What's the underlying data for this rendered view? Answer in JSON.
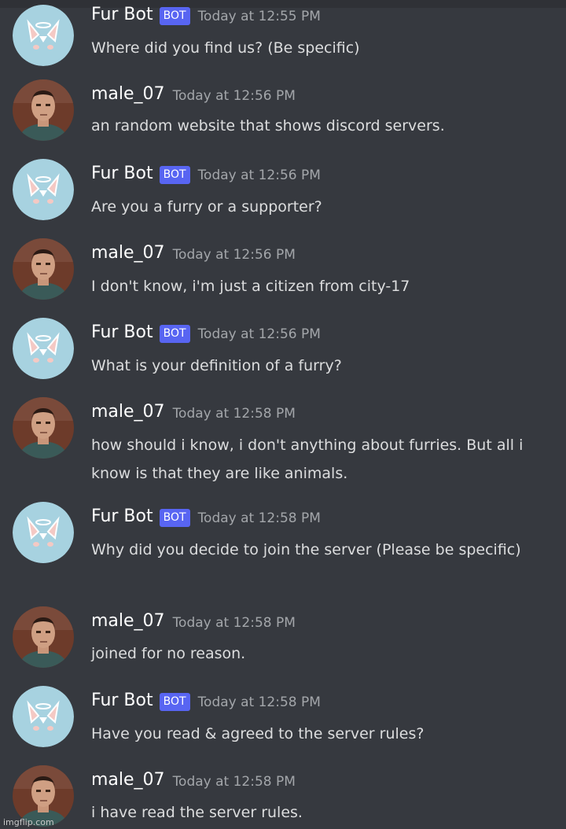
{
  "messages": [
    {
      "author": "Fur Bot",
      "bot": true,
      "badge": "BOT",
      "timestamp": "Today at 12:55 PM",
      "text": "Where did you find us? (Be specific)"
    },
    {
      "author": "male_07",
      "bot": false,
      "timestamp": "Today at 12:56 PM",
      "text": "an random website that shows discord servers."
    },
    {
      "author": "Fur Bot",
      "bot": true,
      "badge": "BOT",
      "timestamp": "Today at 12:56 PM",
      "text": "Are you a furry or a supporter?"
    },
    {
      "author": "male_07",
      "bot": false,
      "timestamp": "Today at 12:56 PM",
      "text": "I don't know, i'm just a citizen from city-17"
    },
    {
      "author": "Fur Bot",
      "bot": true,
      "badge": "BOT",
      "timestamp": "Today at 12:56 PM",
      "text": "What is your definition of a furry?"
    },
    {
      "author": "male_07",
      "bot": false,
      "timestamp": "Today at 12:58 PM",
      "text": "how should i know, i don't anything about furries. But all i know is that they are like animals."
    },
    {
      "author": "Fur Bot",
      "bot": true,
      "badge": "BOT",
      "timestamp": "Today at 12:58 PM",
      "text": "Why did you decide to join the server (Please be specific)"
    },
    {
      "author": "male_07",
      "bot": false,
      "timestamp": "Today at 12:58 PM",
      "text": "joined for no reason."
    },
    {
      "author": "Fur Bot",
      "bot": true,
      "badge": "BOT",
      "timestamp": "Today at 12:58 PM",
      "text": "Have you read & agreed to the server rules?"
    },
    {
      "author": "male_07",
      "bot": false,
      "timestamp": "Today at 12:58 PM",
      "text": "i have read the server rules."
    }
  ],
  "watermark": "imgflip.com",
  "colors": {
    "background": "#36393f",
    "bot_badge": "#5865f2",
    "username": "#ffffff",
    "timestamp": "#a3a6aa",
    "text": "#dcddde"
  },
  "icons": {
    "bot_avatar": "fur-bot-avatar-icon",
    "user_avatar": "male-07-avatar-icon"
  }
}
